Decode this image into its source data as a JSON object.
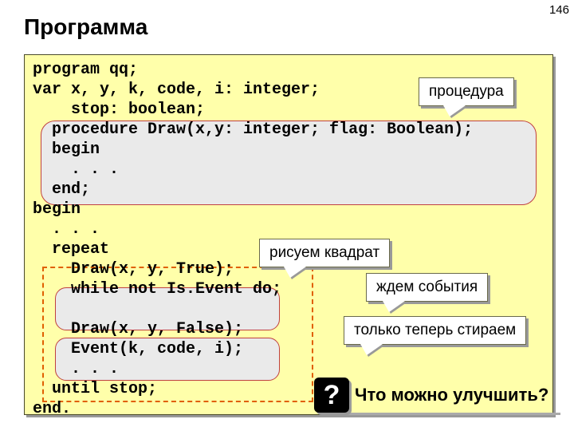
{
  "page_number": "146",
  "title": "Программа",
  "code_text": "program qq;\nvar x, y, k, code, i: integer;\n    stop: boolean;\n  procedure Draw(x,y: integer; flag: Boolean);\n  begin\n    . . .\n  end;\nbegin\n  . . .\n  repeat\n    Draw(x, y, True);\n    while not Is.Event do;\n\n    Draw(x, y, False);\n    Event(k, code, i);\n    . . .\n  until stop;\nend.",
  "callouts": {
    "proc": "процедура",
    "draw": "рисуем квадрат",
    "wait": "ждем события",
    "erase": "только теперь стираем"
  },
  "question": {
    "badge": "?",
    "text": "Что можно улучшить?"
  }
}
